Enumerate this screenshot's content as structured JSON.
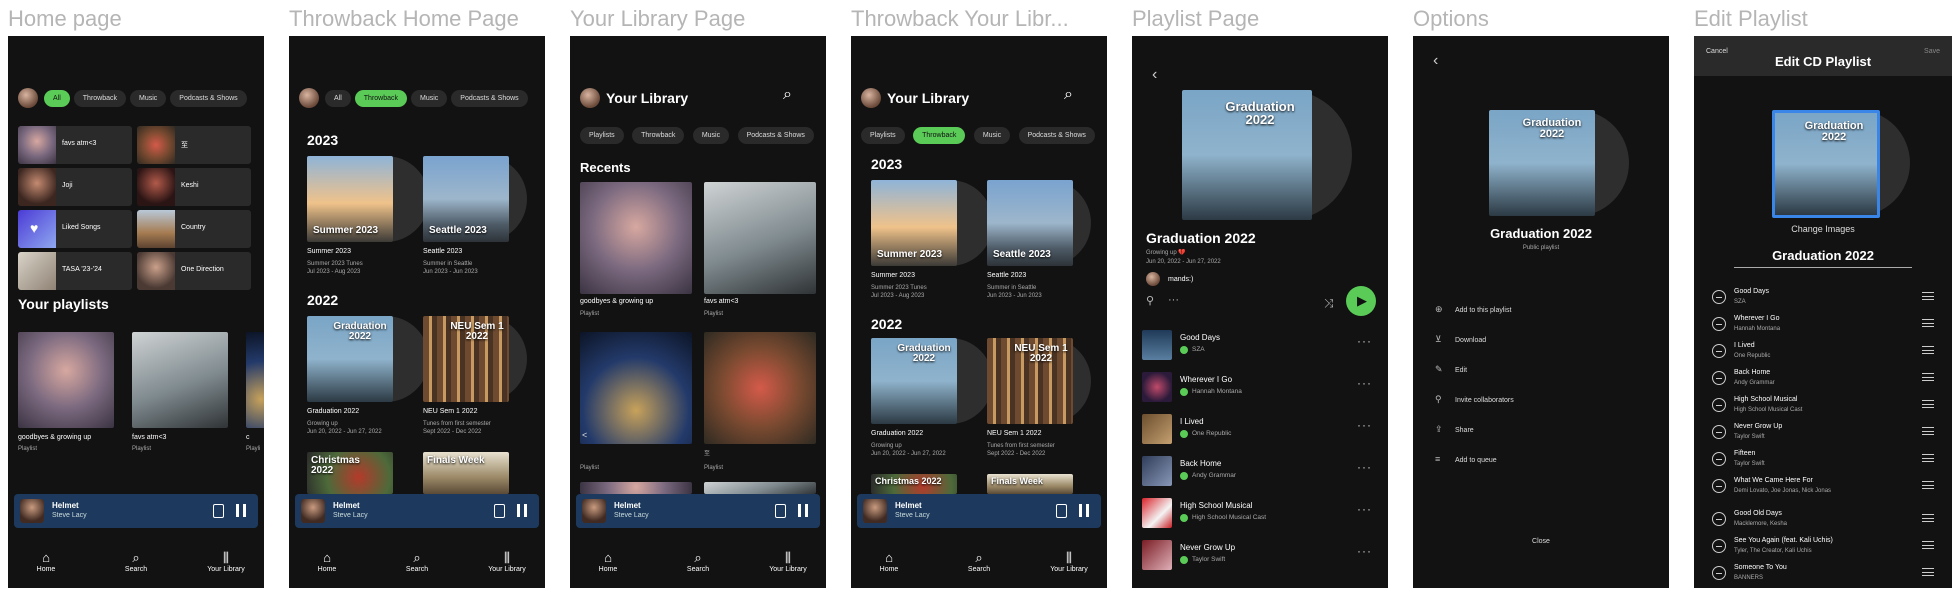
{
  "frames": [
    {
      "title": "Home page"
    },
    {
      "title": "Throwback Home Page"
    },
    {
      "title": "Your Library Page"
    },
    {
      "title": "Throwback Your Libr..."
    },
    {
      "title": "Playlist Page"
    },
    {
      "title": "Options"
    },
    {
      "title": "Edit Playlist"
    }
  ],
  "filters": {
    "home": [
      "All",
      "Throwback",
      "Music",
      "Podcasts & Shows"
    ],
    "library": [
      "Playlists",
      "Throwback",
      "Music",
      "Podcasts & Shows"
    ]
  },
  "home": {
    "tiles": [
      "favs atm<3",
      "至",
      "Joji",
      "Keshi",
      "Liked Songs",
      "Country",
      "TASA '23-'24",
      "One Direction"
    ],
    "your_playlists": "Your playlists",
    "playlists": [
      {
        "name": "goodbyes & growing up",
        "type": "Playlist"
      },
      {
        "name": "favs atm<3",
        "type": "Playlist"
      },
      {
        "name": "c",
        "type": "Playli"
      }
    ]
  },
  "throwback": {
    "years": [
      "2023",
      "2022"
    ],
    "cards_2023": [
      {
        "overlay": "Summer 2023",
        "name": "Summer 2023",
        "desc1": "Summer 2023 Tunes",
        "desc2": "Jul 2023 - Aug 2023"
      },
      {
        "overlay": "Seattle 2023",
        "name": "Seattle 2023",
        "desc1": "Summer in Seattle",
        "desc2": "Jun 2023 - Jun 2023"
      }
    ],
    "cards_2022": [
      {
        "overlay": "Graduation 2022",
        "name": "Graduation 2022",
        "desc1": "Growing up",
        "desc2": "Jun 20, 2022 - Jun 27, 2022"
      },
      {
        "overlay": "NEU Sem 1 2022",
        "name": "NEU Sem 1 2022",
        "desc1": "Tunes from first semester",
        "desc2": "Sept 2022 - Dec 2022"
      }
    ],
    "more": [
      "Christmas 2022",
      "Finals Week"
    ]
  },
  "library": {
    "title": "Your Library",
    "recents": "Recents",
    "items": [
      {
        "name": "goodbyes & growing up",
        "type": "Playlist"
      },
      {
        "name": "favs atm<3",
        "type": "Playlist"
      },
      {
        "name": "",
        "type": "Playlist"
      },
      {
        "name": "",
        "type": "至"
      }
    ],
    "arrow": "<"
  },
  "player": {
    "track": "Helmet",
    "artist": "Steve Lacy"
  },
  "nav": [
    "Home",
    "Search",
    "Your Library"
  ],
  "playlist": {
    "cover_title": "Graduation 2022",
    "title": "Graduation 2022",
    "desc": "Growing up 💔",
    "dates": "Jun 20, 2022 - Jun 27, 2022",
    "owner": "mands:)",
    "tracks": [
      {
        "title": "Good Days",
        "artist": "SZA"
      },
      {
        "title": "Wherever I Go",
        "artist": "Hannah Montana"
      },
      {
        "title": "I Lived",
        "artist": "One Republic"
      },
      {
        "title": "Back Home",
        "artist": "Andy Grammar"
      },
      {
        "title": "High School Musical",
        "artist": "High School Musical Cast"
      },
      {
        "title": "Never Grow Up",
        "artist": "Taylor Swift"
      }
    ]
  },
  "options": {
    "title": "Graduation 2022",
    "subtitle": "Public playlist",
    "items": [
      "Add to this playlist",
      "Download",
      "Edit",
      "Invite collaborators",
      "Share",
      "Add to queue"
    ],
    "close": "Close"
  },
  "edit": {
    "cancel": "Cancel",
    "title": "Edit CD Playlist",
    "save": "Save",
    "change_images": "Change Images",
    "name": "Graduation 2022",
    "tracks": [
      {
        "title": "Good Days",
        "artist": "SZA"
      },
      {
        "title": "Wherever I Go",
        "artist": "Hannah Montana"
      },
      {
        "title": "I Lived",
        "artist": "One Republic"
      },
      {
        "title": "Back Home",
        "artist": "Andy Grammar"
      },
      {
        "title": "High School Musical",
        "artist": "High School Musical Cast"
      },
      {
        "title": "Never Grow Up",
        "artist": "Taylor Swift"
      },
      {
        "title": "Fifteen",
        "artist": "Taylor Swift"
      },
      {
        "title": "What We Came Here For",
        "artist": "Demi Lovato, Joe Jonas, Nick Jonas"
      },
      {
        "title": "Good Old Days",
        "artist": "Macklemore, Kesha"
      },
      {
        "title": "See You Again (feat. Kali Uchis)",
        "artist": "Tyler, The Creator, Kali Uchis"
      },
      {
        "title": "Someone To You",
        "artist": "BANNERS"
      }
    ]
  },
  "colors": {
    "accent": "#5acb57",
    "background": "#121212",
    "player": "#1d3a5e",
    "edit_highlight": "#3a86e8"
  }
}
